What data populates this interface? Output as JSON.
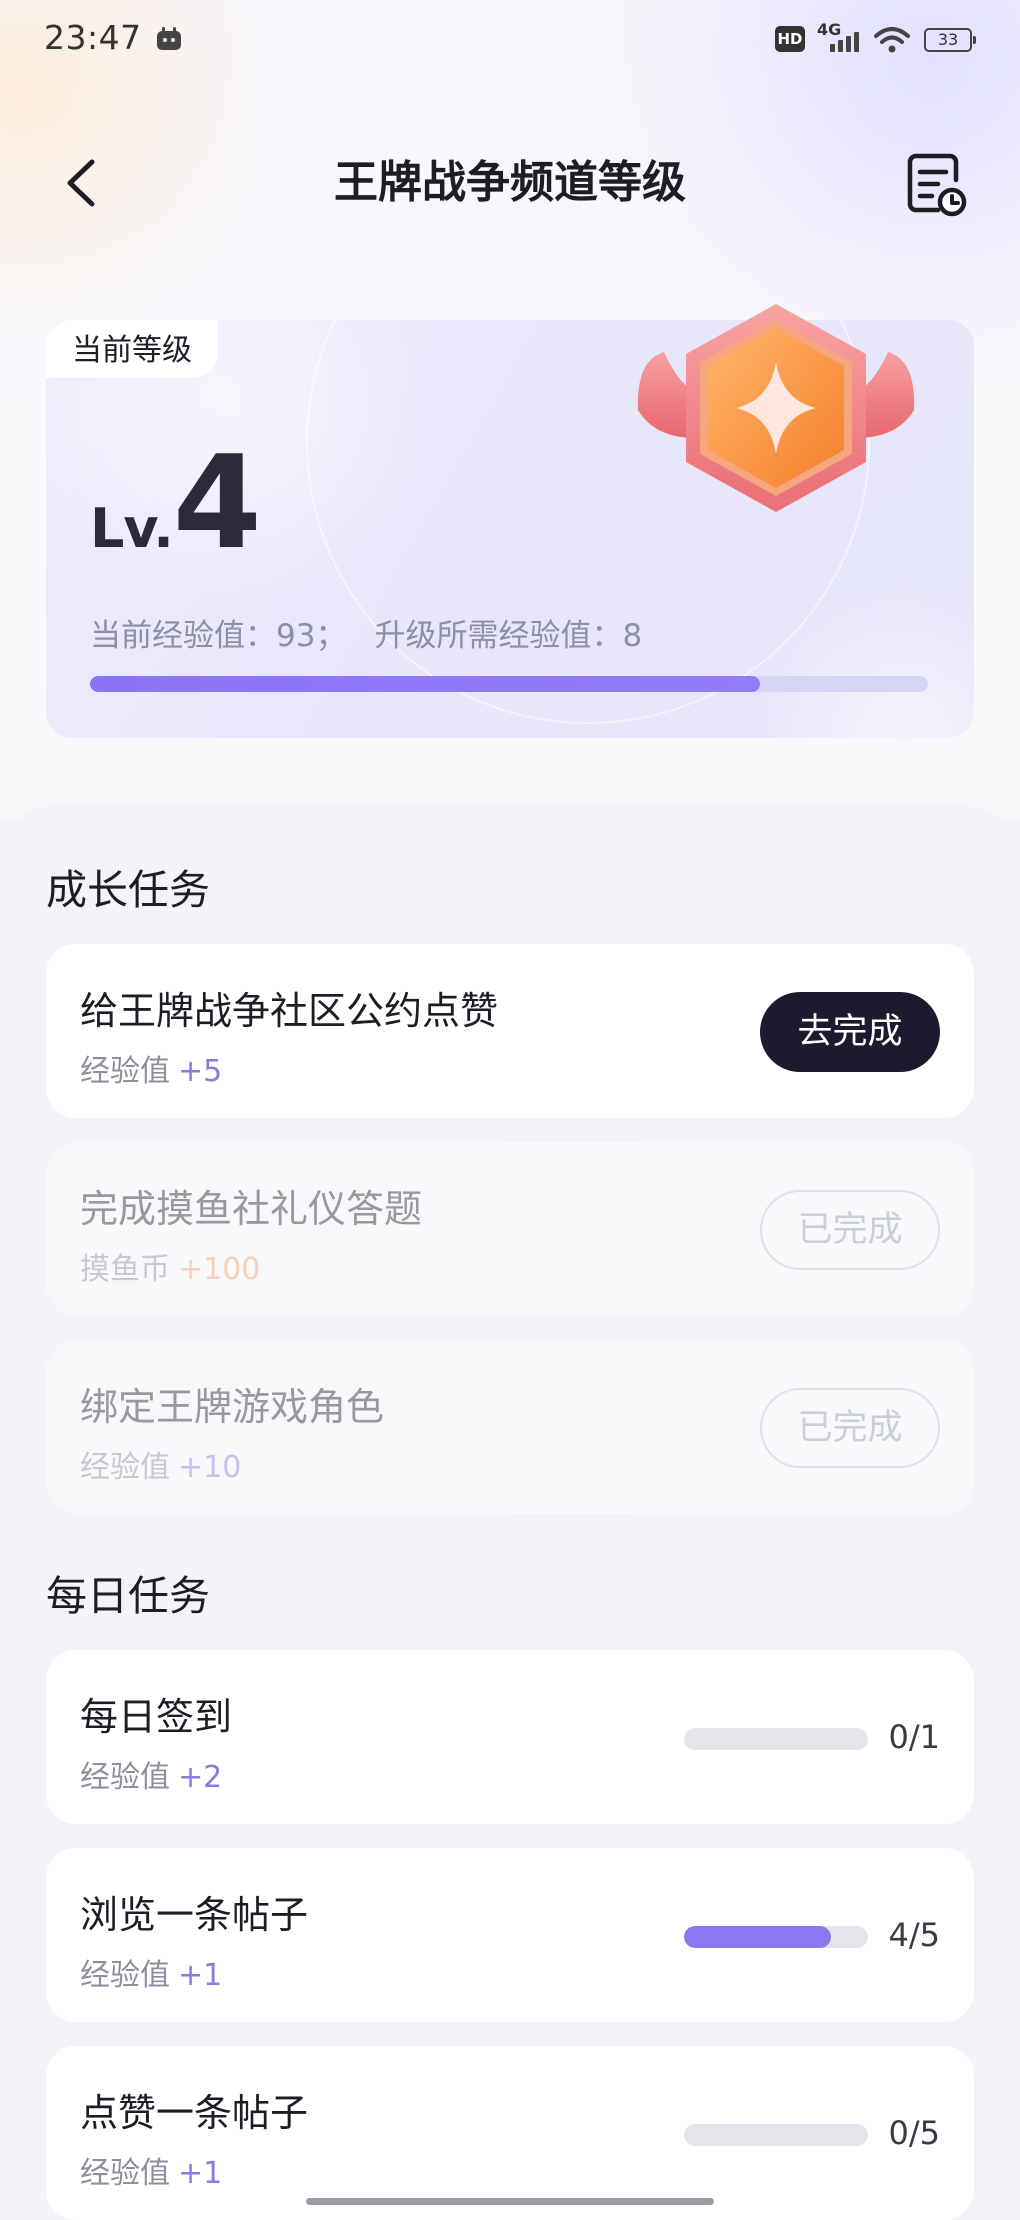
{
  "status_bar": {
    "time": "23:47",
    "network": "4G",
    "hd": "HD",
    "battery": "33",
    "icons": [
      "app-notification-icon",
      "hd-icon",
      "signal-icon",
      "wifi-icon",
      "battery-icon"
    ]
  },
  "header": {
    "title": "王牌战争频道等级",
    "back_icon": "chevron-left-icon",
    "history_icon": "record-clock-icon"
  },
  "level": {
    "tag": "当前等级",
    "prefix": "Lv.",
    "number": "4",
    "exp_label": "当前经验值：93；",
    "next_label": "升级所需经验值：8",
    "progress": 0.8,
    "badge_icon": "winged-hexagon-star-badge"
  },
  "growth": {
    "title": "成长任务",
    "tasks": [
      {
        "title": "给王牌战争社区公约点赞",
        "reward_label": "经验值",
        "reward_value": "+5",
        "button": "去完成",
        "state": "todo"
      },
      {
        "title": "完成摸鱼社礼仪答题",
        "reward_label": "摸鱼币",
        "reward_value": "+100",
        "button": "已完成",
        "state": "done"
      },
      {
        "title": "绑定王牌游戏角色",
        "reward_label": "经验值",
        "reward_value": "+10",
        "button": "已完成",
        "state": "done"
      }
    ]
  },
  "daily": {
    "title": "每日任务",
    "tasks": [
      {
        "title": "每日签到",
        "reward_label": "经验值",
        "reward_value": "+2",
        "count": "0/1",
        "progress": 0.0
      },
      {
        "title": "浏览一条帖子",
        "reward_label": "经验值",
        "reward_value": "+1",
        "count": "4/5",
        "progress": 0.8
      },
      {
        "title": "点赞一条帖子",
        "reward_label": "经验值",
        "reward_value": "+1",
        "count": "0/5",
        "progress": 0.0
      }
    ]
  },
  "colors": {
    "accent": "#8a78f0",
    "dark_button": "#1c1a2e",
    "coin": "#f7a05f",
    "badge_orange": "#f6872b",
    "badge_pink": "#f27d7f"
  }
}
